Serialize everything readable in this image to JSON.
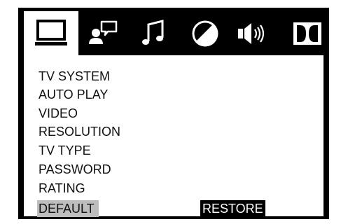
{
  "tabs": [
    {
      "icon": "monitor-icon",
      "label": ""
    },
    {
      "icon": "speech-bubble-person-icon",
      "label": ""
    },
    {
      "icon": "music-note-icon",
      "label": ""
    },
    {
      "icon": "contrast-circle-icon",
      "label": ""
    },
    {
      "icon": "speaker-volume-icon",
      "label": ""
    },
    {
      "icon": "dolby-icon",
      "label": ""
    }
  ],
  "menu": {
    "items": [
      "TV SYSTEM",
      "AUTO PLAY",
      "VIDEO",
      "RESOLUTION",
      "TV TYPE",
      "PASSWORD",
      "RATING",
      "DEFAULT"
    ],
    "selected_item": "DEFAULT",
    "selected_value": "RESTORE"
  },
  "colors": {
    "frame": "#000000",
    "background": "#ffffff",
    "selection_highlight": "#bdbdbd",
    "value_background": "#000000",
    "value_text": "#ffffff"
  }
}
